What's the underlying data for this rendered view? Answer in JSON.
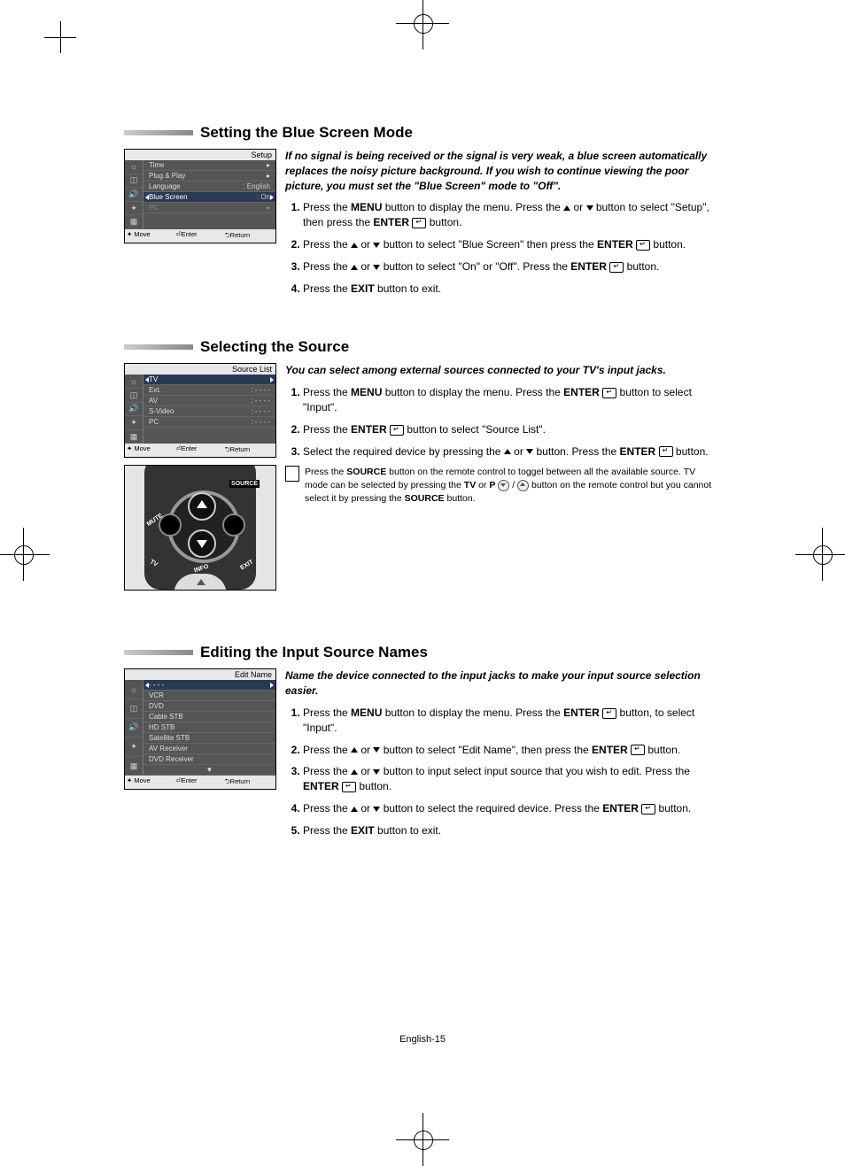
{
  "footer": "English-15",
  "sections": [
    {
      "title": "Setting the Blue Screen Mode",
      "intro": "If no signal is being received or the signal is very weak, a blue screen automatically replaces the noisy picture background. If you wish to continue viewing the poor picture, you must set the \"Blue Screen\" mode to \"Off\".",
      "steps": [
        {
          "pre": "Press the ",
          "b1": "MENU",
          "mid1": " button to display the menu. Press the ",
          "arrows": true,
          "mid2": " button to select \"Setup\", then press the ",
          "b2": "ENTER",
          "enter": true,
          "post": " button."
        },
        {
          "pre": "Press the ",
          "arrows": true,
          "mid1": " button to select \"Blue Screen\" then press the ",
          "b1": "ENTER",
          "enter": true,
          "post": " button."
        },
        {
          "pre": "Press the ",
          "arrows": true,
          "mid1": " button to select \"On\" or \"Off\". Press the ",
          "b1": "ENTER",
          "enter": true,
          "post": " button."
        },
        {
          "pre": "Press the ",
          "b1": "EXIT",
          "post": " button to exit."
        }
      ],
      "osd": {
        "title": "Setup",
        "rows": [
          {
            "label": "Time",
            "val": ""
          },
          {
            "label": "Plug & Play",
            "val": ""
          },
          {
            "label": "Language",
            "val": ": English"
          },
          {
            "label": "Blue Screen",
            "val": ": On",
            "sel": true
          },
          {
            "label": "PC",
            "val": "",
            "dim": true
          }
        ],
        "foot": [
          "✦ Move",
          "⏎Enter",
          "⮌Return"
        ]
      }
    },
    {
      "title": "Selecting the Source",
      "intro": "You can select among external sources connected to your TV's input jacks.",
      "steps": [
        {
          "pre": "Press the ",
          "b1": "MENU",
          "mid1": " button to display the menu. Press the ",
          "b2": "ENTER",
          "enter": true,
          "post": " button to select \"Input\"."
        },
        {
          "pre": "Press the ",
          "b1": "ENTER",
          "enter": true,
          "post": " button to select \"Source List\"."
        },
        {
          "pre": "Select the required device by pressing the ",
          "arrows": true,
          "mid1": " button. Press the ",
          "b1": "ENTER",
          "enter": true,
          "post": " button."
        }
      ],
      "note": {
        "p1": "Press the ",
        "b1": "SOURCE",
        "p2": " button on the remote control to toggel between all the available source. TV mode can be selected by pressing the ",
        "b2": "TV",
        "p3": " or ",
        "b3": "P",
        "p4": " button on the remote control but you cannot select it by pressing the ",
        "b4": "SOURCE",
        "p5": " button."
      },
      "osd": {
        "title": "Source List",
        "rows": [
          {
            "label": "TV",
            "val": "",
            "sel": true
          },
          {
            "label": "Ext.",
            "val": ": - - - -"
          },
          {
            "label": "AV",
            "val": ": - - - -"
          },
          {
            "label": "S-Video",
            "val": ": - - - -"
          },
          {
            "label": "PC",
            "val": ": - - - -"
          }
        ],
        "foot": [
          "✦ Move",
          "⏎Enter",
          "⮌Return"
        ]
      },
      "remote": {
        "labels": {
          "source": "SOURCE",
          "mute": "MUTE",
          "tv": "TV",
          "info": "INFO",
          "exit": "EXIT"
        }
      }
    },
    {
      "title": "Editing the Input Source Names",
      "intro": "Name the device connected to the input jacks to make your input source selection easier.",
      "steps": [
        {
          "pre": "Press the ",
          "b1": "MENU",
          "mid1": " button to display the menu. Press the ",
          "b2": "ENTER",
          "enter": true,
          "post": " button, to select \"Input\"."
        },
        {
          "pre": "Press the ",
          "arrows": true,
          "mid1": " button to select \"Edit Name\", then press the ",
          "b1": "ENTER",
          "enter": true,
          "post": " button."
        },
        {
          "pre": "Press the ",
          "arrows": true,
          "mid1": " button to input select input source that you wish to edit. Press the ",
          "b1": "ENTER",
          "enter": true,
          "post": " button."
        },
        {
          "pre": "Press the ",
          "arrows": true,
          "mid1": " button to select the required device. Press the ",
          "b1": "ENTER",
          "enter": true,
          "post": " button."
        },
        {
          "pre": "Press the ",
          "b1": "EXIT",
          "post": " button to exit."
        }
      ],
      "osd": {
        "title": "Edit Name",
        "rows": [
          {
            "label": "- - - -",
            "val": "",
            "sel": true
          },
          {
            "label": "VCR",
            "val": ""
          },
          {
            "label": "DVD",
            "val": ""
          },
          {
            "label": "Cable STB",
            "val": ""
          },
          {
            "label": "HD STB",
            "val": ""
          },
          {
            "label": "Satellite STB",
            "val": ""
          },
          {
            "label": "AV Receiver",
            "val": ""
          },
          {
            "label": "DVD Receiver",
            "val": ""
          },
          {
            "label": "▼",
            "val": ""
          }
        ],
        "foot": [
          "✦ Move",
          "⏎Enter",
          "⮌Return"
        ]
      }
    }
  ]
}
